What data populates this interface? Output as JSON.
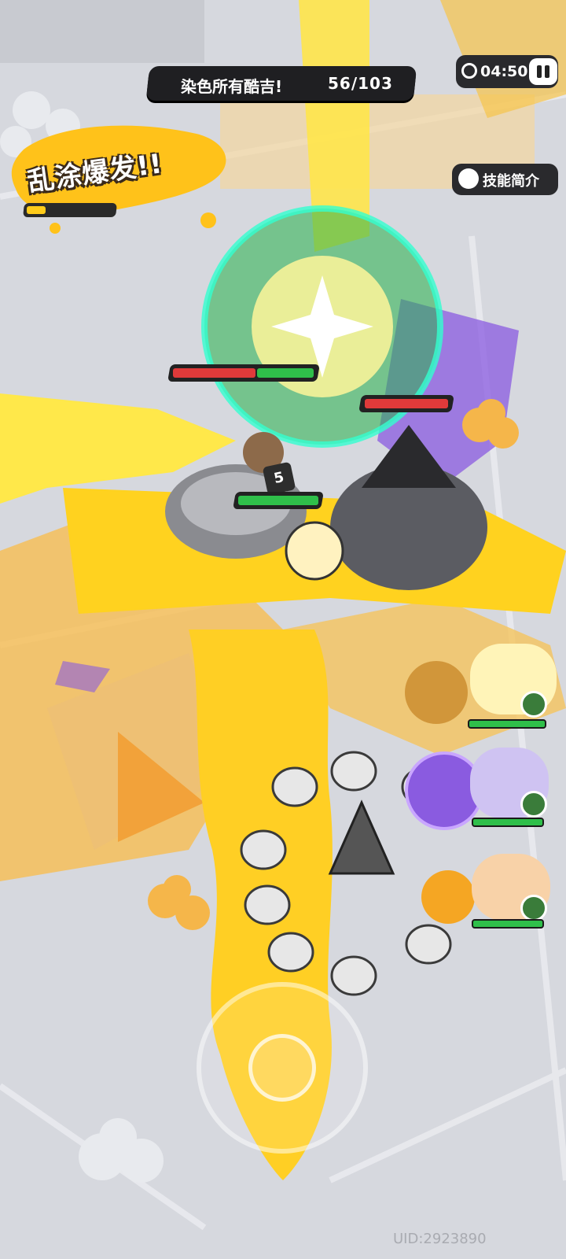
{
  "hud": {
    "mission_text": "染色所有酷吉!",
    "mission_progress": "56/103",
    "timer": "04:50",
    "skill_button_label": "技能简介",
    "splash_title": "乱涂爆发!!",
    "splash_meter_fill": 0.15
  },
  "enemies": [
    {
      "name": "rhino",
      "hp_red": 0.45,
      "hp_green": 0.5
    },
    {
      "name": "witch-blob",
      "hp_red": 0.95,
      "hp_green": 0
    }
  ],
  "player": {
    "level": "5",
    "hp": 0.95
  },
  "team": [
    {
      "name": "blonde-hero",
      "hp": 1.0
    },
    {
      "name": "purple-hero",
      "hp": 1.0
    },
    {
      "name": "orange-hero",
      "hp": 1.0
    }
  ],
  "uid": "UID:2923890",
  "colors": {
    "paint_yellow": "#ffd21f",
    "paint_orange": "#f5a623",
    "hud_dark": "#1f1f22",
    "hp_green": "#2fbf4a",
    "hp_red": "#e03a3a",
    "purple_ink": "#8a5be0"
  }
}
